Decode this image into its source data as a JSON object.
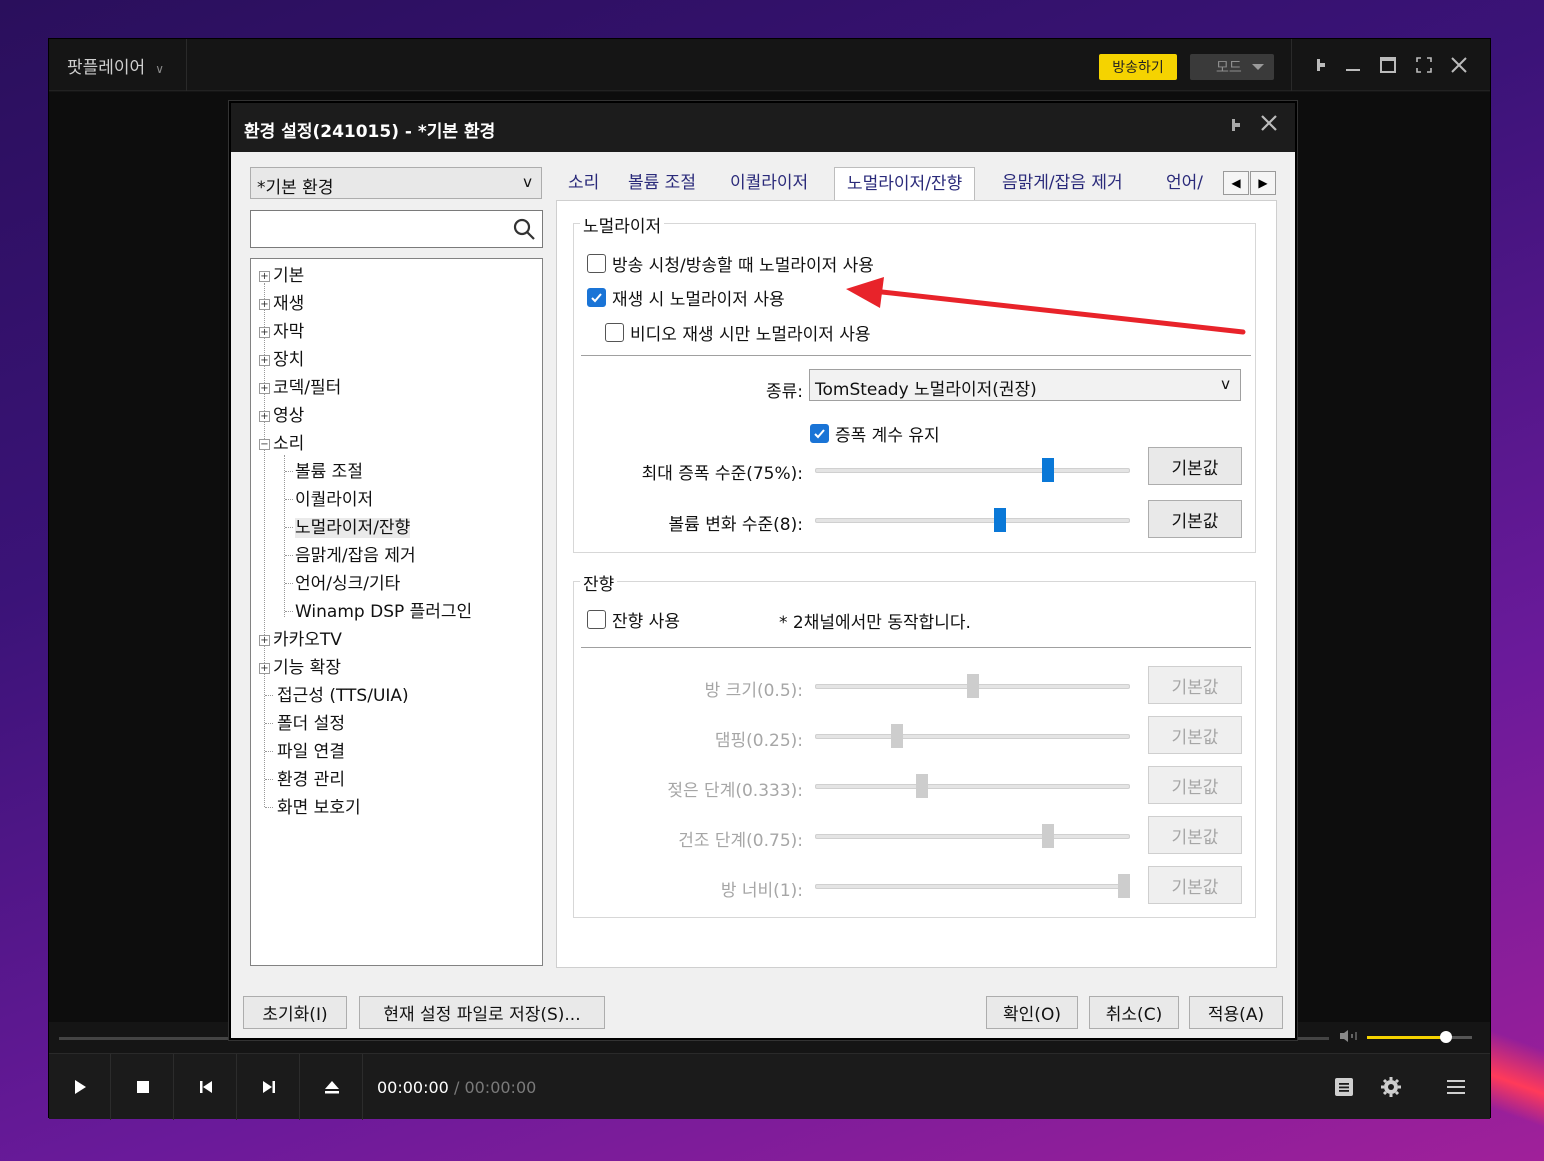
{
  "player": {
    "app_name": "팟플레이어",
    "broadcast_label": "방송하기",
    "mode_label": "모드",
    "time_current": "00:00:00",
    "time_separator": "/",
    "time_total": "00:00:00",
    "volume_level": 0.75
  },
  "dialog": {
    "title": "환경 설정(241015) - *기본 환경",
    "profile": "*기본 환경",
    "profile_chevron": "v",
    "search_placeholder": "",
    "tree": {
      "basic": "기본",
      "playback": "재생",
      "subtitle": "자막",
      "device": "장치",
      "codec": "코덱/필터",
      "video": "영상",
      "sound": "소리",
      "sound_children": {
        "volume": "볼륨 조절",
        "equalizer": "이퀄라이저",
        "normalizer": "노멀라이저/잔향",
        "denoise": "음맑게/잡음 제거",
        "language": "언어/싱크/기타",
        "winamp": "Winamp DSP 플러그인"
      },
      "kakao": "카카오TV",
      "extension": "기능 확장",
      "accessibility": "접근성 (TTS/UIA)",
      "folder": "폴더 설정",
      "file_assoc": "파일 연결",
      "env_manage": "환경 관리",
      "screensaver": "화면 보호기"
    },
    "tabs": [
      "소리",
      "볼륨 조절",
      "이퀄라이저",
      "노멀라이저/잔향",
      "음맑게/잡음 제거",
      "언어/싱"
    ],
    "normalizer": {
      "group_title": "노멀라이저",
      "cb_broadcast": "방송 시청/방송할 때 노멀라이저 사용",
      "cb_broadcast_checked": false,
      "cb_playback": "재생 시 노멀라이저 사용",
      "cb_playback_checked": true,
      "cb_video_only": "비디오 재생 시만 노멀라이저 사용",
      "cb_video_only_checked": false,
      "type_label": "종류:",
      "type_value": "TomSteady 노멀라이저(권장)",
      "type_chevron": "v",
      "cb_keep_gain": "증폭 계수 유지",
      "cb_keep_gain_checked": true,
      "max_amp_label": "최대 증폭 수준(75%):",
      "max_amp_level": 0.75,
      "volume_change_label": "볼륨 변화 수준(8):",
      "volume_change_level": 0.59
    },
    "reverb": {
      "group_title": "잔향",
      "cb_use": "잔향 사용",
      "cb_use_checked": false,
      "note": "* 2채널에서만 동작합니다.",
      "room_size_label": "방 크기(0.5):",
      "room_size_level": 0.5,
      "damping_label": "댐핑(0.25):",
      "damping_level": 0.25,
      "wet_label": "젖은 단계(0.333):",
      "wet_level": 0.333,
      "dry_label": "건조 단계(0.75):",
      "dry_level": 0.75,
      "width_label": "방 너비(1):",
      "width_level": 1.0
    },
    "default_label": "기본값",
    "buttons": {
      "reset": "초기화(I)",
      "save_file": "현재 설정 파일로 저장(S)...",
      "ok": "확인(O)",
      "cancel": "취소(C)",
      "apply": "적용(A)"
    }
  },
  "colors": {
    "accent_yellow": "#f5d300",
    "checkbox_blue": "#1a74d6",
    "slider_blue": "#0a78d7",
    "annotation_red": "#e8232a"
  }
}
